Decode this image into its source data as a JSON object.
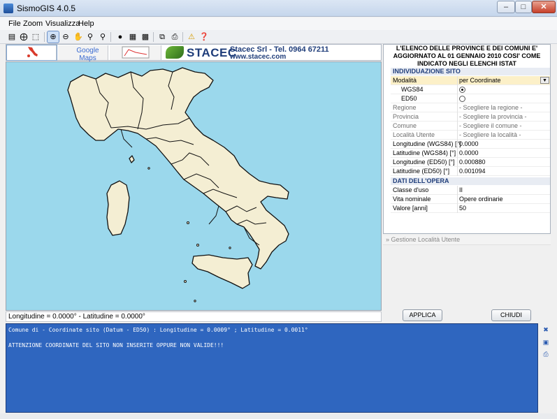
{
  "window": {
    "title": "SismoGIS 4.0.5",
    "min": "–",
    "max": "□",
    "close": "✕"
  },
  "menu": [
    "File",
    "Zoom",
    "Visualizza",
    "Help"
  ],
  "tabs": {
    "google_label": "Google Maps"
  },
  "banner": {
    "logo_text": "STACEC",
    "company": "Stacec Srl - Tel. 0964 67211",
    "url": "www.stacec.com"
  },
  "map": {
    "coordinates": "Longitudine = 0.0000° - Latitudine = 0.0000°",
    "land_color": "#f4eed3",
    "sea_color": "#9bd8ec"
  },
  "panel": {
    "header": "L'ELENCO DELLE PROVINCE E DEI COMUNI E' AGGIORNATO AL 01 GENNAIO 2010 COSI' COME INDICATO NEGLI ELENCHI ISTAT",
    "section_site": "INDIVIDUAZIONE SITO",
    "section_opera": "DATI DELL'OPERA",
    "rows": {
      "modalita": {
        "k": "Modalità",
        "v": "per Coordinate"
      },
      "wgs84": {
        "k": "WGS84"
      },
      "ed50": {
        "k": "ED50"
      },
      "regione": {
        "k": "Regione",
        "v": "- Scegliere la regione -"
      },
      "provincia": {
        "k": "Provincia",
        "v": "- Scegliere la provincia -"
      },
      "comune": {
        "k": "Comune",
        "v": "- Scegliere il comune -"
      },
      "localita": {
        "k": "Località Utente",
        "v": "- Scegliere la località -"
      },
      "lon_wgs": {
        "k": "Longitudine (WGS84) [°]",
        "v": "0.0000"
      },
      "lat_wgs": {
        "k": "Latitudine (WGS84) [°]",
        "v": "0.0000"
      },
      "lon_ed": {
        "k": "Longitudine (ED50) [°]",
        "v": "0.000880"
      },
      "lat_ed": {
        "k": "Latitudine (ED50) [°]",
        "v": "0.001094"
      },
      "classe": {
        "k": "Classe d'uso",
        "v": "II"
      },
      "vita": {
        "k": "Vita nominale",
        "v": "Opere ordinarie"
      },
      "valore": {
        "k": "Valore [anni]",
        "v": "50"
      }
    },
    "gestione": "Gestione Località Utente"
  },
  "buttons": {
    "applica": "APPLICA",
    "chiudi": "CHIUDI"
  },
  "console": {
    "line1": "Comune di  - Coordinate sito (Datum - ED50) : Longitudine = 0.0009° ; Latitudine = 0.0011°",
    "line2": "ATTENZIONE COORDINATE DEL SITO NON INSERITE OPPURE NON VALIDE!!!"
  }
}
